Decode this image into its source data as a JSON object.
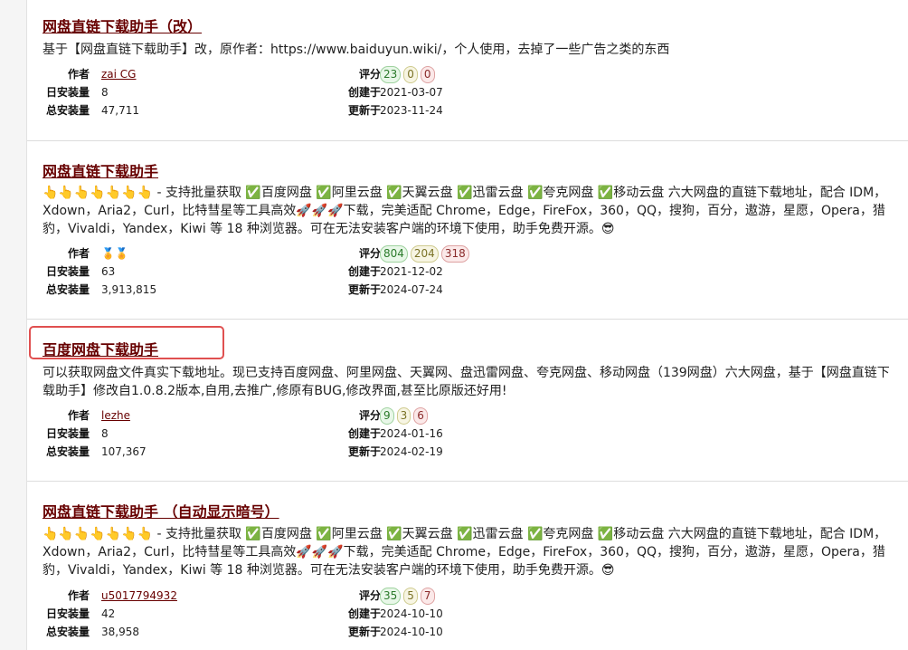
{
  "labels": {
    "author": "作者",
    "daily": "日安装量",
    "total": "总安装量",
    "rating": "评分",
    "created": "创建于",
    "updated": "更新于"
  },
  "scripts": [
    {
      "title": "网盘直链下载助手（改）",
      "description": "基于【网盘直链下载助手】改，原作者：https://www.baiduyun.wiki/，个人使用，去掉了一些广告之类的东西",
      "author": "zai CG",
      "daily_installs": "8",
      "total_installs": "47,711",
      "rating_good": "23",
      "rating_ok": "0",
      "rating_bad": "0",
      "created": "2021-03-07",
      "updated": "2023-11-24"
    },
    {
      "title": "网盘直链下载助手",
      "description": "👆👆👆👆👆👆👆 - 支持批量获取 ✅百度网盘 ✅阿里云盘 ✅天翼云盘 ✅迅雷云盘 ✅夸克网盘 ✅移动云盘 六大网盘的直链下载地址，配合 IDM，Xdown，Aria2，Curl，比特彗星等工具高效🚀🚀🚀下载，完美适配 Chrome，Edge，FireFox，360，QQ，搜狗，百分，遨游，星愿，Opera，猎豹，Vivaldi，Yandex，Kiwi 等 18 种浏览器。可在无法安装客户端的环境下使用，助手免费开源。😎",
      "author": "🏅🏅",
      "daily_installs": "63",
      "total_installs": "3,913,815",
      "rating_good": "804",
      "rating_ok": "204",
      "rating_bad": "318",
      "created": "2021-12-02",
      "updated": "2024-07-24"
    },
    {
      "title": "百度网盘下载助手",
      "description": "可以获取网盘文件真实下载地址。现已支持百度网盘、阿里网盘、天翼网、盘迅雷网盘、夸克网盘、移动网盘（139网盘）六大网盘，基于【网盘直链下载助手】修改自1.0.8.2版本,自用,去推广,修原有BUG,修改界面,甚至比原版还好用!",
      "author": "lezhe",
      "daily_installs": "8",
      "total_installs": "107,367",
      "rating_good": "9",
      "rating_ok": "3",
      "rating_bad": "6",
      "created": "2024-01-16",
      "updated": "2024-02-19"
    },
    {
      "title": "网盘直链下载助手 （自动显示暗号）",
      "description": "👆👆👆👆👆👆👆 - 支持批量获取 ✅百度网盘 ✅阿里云盘 ✅天翼云盘 ✅迅雷云盘 ✅夸克网盘 ✅移动云盘 六大网盘的直链下载地址，配合 IDM，Xdown，Aria2，Curl，比特彗星等工具高效🚀🚀🚀下载，完美适配 Chrome，Edge，FireFox，360，QQ，搜狗，百分，遨游，星愿，Opera，猎豹，Vivaldi，Yandex，Kiwi 等 18 种浏览器。可在无法安装客户端的环境下使用，助手免费开源。😎",
      "author": "u5017794932",
      "daily_installs": "42",
      "total_installs": "38,958",
      "rating_good": "35",
      "rating_ok": "5",
      "rating_bad": "7",
      "created": "2024-10-10",
      "updated": "2024-10-10"
    }
  ],
  "colors": {
    "title": "#670000",
    "highlight_border": "#e05050",
    "rating_good": "#2a7a2a",
    "rating_ok": "#7a7226",
    "rating_bad": "#8a2a2a"
  }
}
